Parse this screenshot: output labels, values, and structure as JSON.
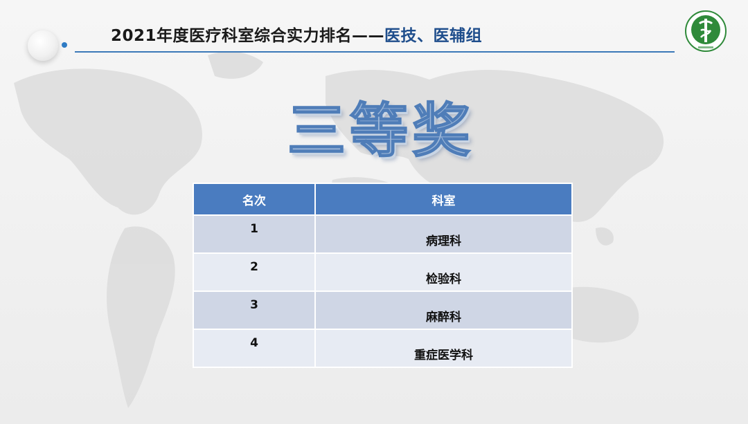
{
  "header": {
    "title_main": "2021年度医疗科室综合实力排名——",
    "title_sub": "医技、医辅组"
  },
  "award": "三等奖",
  "table": {
    "headers": [
      "名次",
      "科室"
    ],
    "rows": [
      {
        "rank": "1",
        "dept": "病理科"
      },
      {
        "rank": "2",
        "dept": "检验科"
      },
      {
        "rank": "3",
        "dept": "麻醉科"
      },
      {
        "rank": "4",
        "dept": "重症医学科"
      }
    ]
  },
  "colors": {
    "header_bg": "#4a7cc0",
    "row_odd": "#cfd6e5",
    "row_even": "#e7ebf3",
    "accent": "#2e7bc4",
    "logo_green": "#2f8a3a"
  },
  "icons": {
    "logo": "hospital-emblem-icon"
  }
}
